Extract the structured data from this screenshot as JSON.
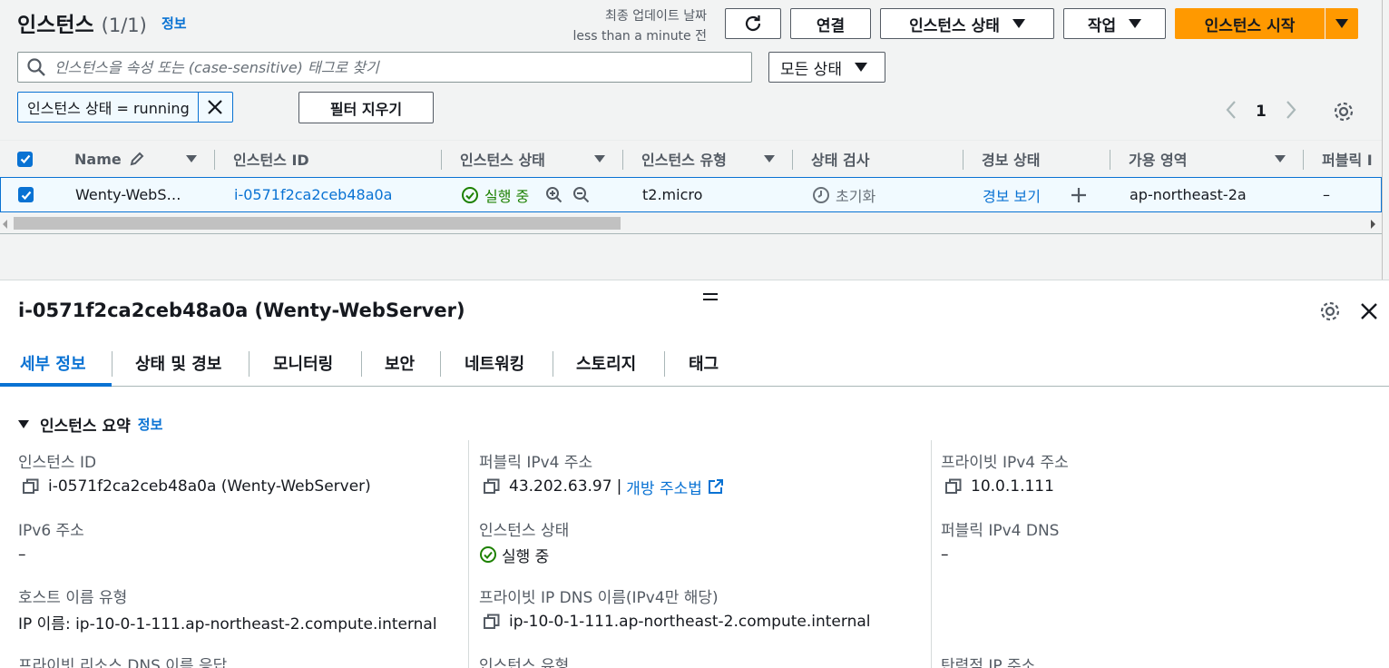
{
  "header": {
    "title": "인스턴스",
    "count": "(1/1)",
    "info_link": "정보",
    "last_update_label": "최종 업데이트 날짜",
    "last_update_value": "less than a minute 전"
  },
  "toolbar": {
    "connect_label": "연결",
    "instance_state_label": "인스턴스 상태",
    "actions_label": "작업",
    "launch_label": "인스턴스 시작"
  },
  "search": {
    "placeholder": "인스턴스을 속성 또는 (case-sensitive) 태그로 찾기",
    "status_select": "모든 상태"
  },
  "filter": {
    "token_label": "인스턴스 상태 = running",
    "clear_label": "필터 지우기"
  },
  "pagination": {
    "current_page": "1"
  },
  "table": {
    "columns": [
      "Name",
      "인스턴스 ID",
      "인스턴스 상태",
      "인스턴스 유형",
      "상태 검사",
      "경보 상태",
      "가용 영역",
      "퍼블릭 I"
    ],
    "rows": [
      {
        "name": "Wenty-WebS…",
        "instance_id": "i-0571f2ca2ceb48a0a",
        "state": "실행 중",
        "type": "t2.micro",
        "status_check": "초기화",
        "alarm": "경보 보기",
        "az": "ap-northeast-2a",
        "public_ip": "–"
      }
    ]
  },
  "detail": {
    "title": "i-0571f2ca2ceb48a0a (Wenty-WebServer)",
    "tabs": [
      "세부 정보",
      "상태 및 경보",
      "모니터링",
      "보안",
      "네트워킹",
      "스토리지",
      "태그"
    ],
    "summary_title": "인스턴스 요약",
    "summary_info": "정보",
    "fields": {
      "instance_id_label": "인스턴스 ID",
      "instance_id_value": "i-0571f2ca2ceb48a0a (Wenty-WebServer)",
      "public_ipv4_label": "퍼블릭 IPv4 주소",
      "public_ipv4_value": "43.202.63.97",
      "public_ipv4_sep": "|",
      "open_address_link": "개방 주소법",
      "private_ipv4_label": "프라이빗 IPv4 주소",
      "private_ipv4_value": "10.0.1.111",
      "ipv6_label": "IPv6 주소",
      "ipv6_value": "–",
      "instance_state_label": "인스턴스 상태",
      "instance_state_value": "실행 중",
      "public_dns_label": "퍼블릭 IPv4 DNS",
      "public_dns_value": "–",
      "hostname_type_label": "호스트 이름 유형",
      "hostname_type_value": "IP 이름: ip-10-0-1-111.ap-northeast-2.compute.internal",
      "private_dns_label": "프라이빗 IP DNS 이름(IPv4만 해당)",
      "private_dns_value": "ip-10-0-1-111.ap-northeast-2.compute.internal",
      "private_resource_dns_label": "프라이빗 리소스 DNS 이름 응답",
      "instance_type_label": "인스턴스 유형",
      "elastic_ip_label": "탄력적 IP 주소"
    }
  },
  "colors": {
    "accent": "#0972d3",
    "primary_button": "#ff9900",
    "success": "#1d8102"
  }
}
